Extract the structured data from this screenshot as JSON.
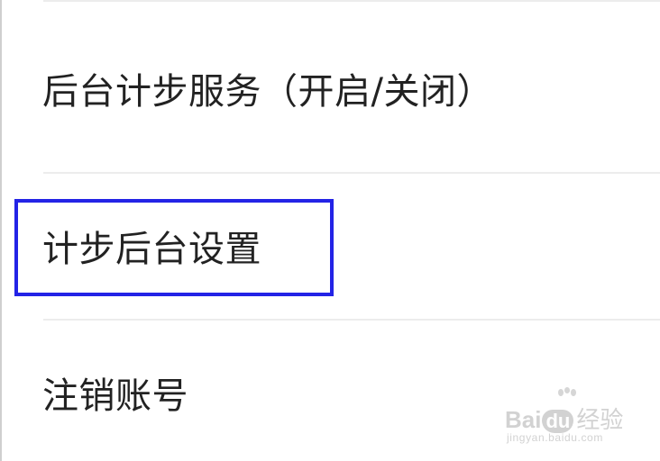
{
  "settings": {
    "items": [
      {
        "label": "后台计步服务（开启/关闭）"
      },
      {
        "label": "计步后台设置",
        "highlighted": true
      },
      {
        "label": "注销账号"
      }
    ],
    "highlight_color": "#2323e6"
  },
  "watermark": {
    "brand_prefix": "Bai",
    "brand_du": "du",
    "brand_suffix": "经验",
    "url": "jingyan.baidu.com",
    "icon": "paw-icon"
  }
}
